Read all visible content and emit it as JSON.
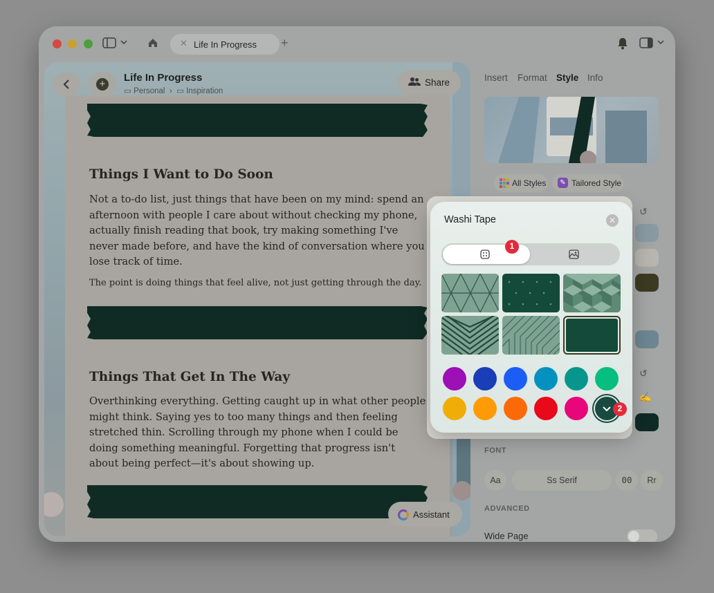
{
  "window": {
    "tab_title": "Life In Progress"
  },
  "header": {
    "title": "Life In Progress",
    "breadcrumb": [
      "Personal",
      "Inspiration"
    ],
    "share_label": "Share"
  },
  "document": {
    "section1_heading": "Things I Want to Do Soon",
    "section1_body": "Not a to-do list, just things that have been on my mind: spend an afternoon with people I care about without checking my phone, actually finish reading that book, try making something I've never made before, and have the kind of conversation where you lose track of time.",
    "section1_note": "The point is doing things that feel alive, not just getting through the day.",
    "section2_heading": "Things That Get In The Way",
    "section2_body": "Overthinking everything. Getting caught up in what other people might think. Saying yes to too many things and then feeling stretched thin. Scrolling through my phone when I could be doing something meaningful. Forgetting that progress isn't about being perfect—it's about showing up.",
    "assistant_label": "Assistant"
  },
  "sidebar": {
    "tabs": [
      "Insert",
      "Format",
      "Style",
      "Info"
    ],
    "active_tab": "Style",
    "all_styles_label": "All Styles",
    "tailored_style_label": "Tailored Style",
    "font_section_label": "FONT",
    "font_options": [
      "Aa",
      "Ss Serif",
      "00",
      "Rr"
    ],
    "advanced_label": "ADVANCED",
    "wide_page_label": "Wide Page",
    "swatch_color": "#0f2b24"
  },
  "popover": {
    "title": "Washi Tape",
    "badges": [
      "1",
      "2"
    ],
    "selected_segment": "pattern",
    "patterns": [
      "triangles",
      "dots",
      "cubes",
      "chevrons",
      "lines",
      "solid"
    ],
    "selected_pattern": "solid",
    "colors": [
      "#9c10b5",
      "#1a3db8",
      "#1c5ef5",
      "#0591c0",
      "#06968d",
      "#07bd80",
      "#f0ad07",
      "#ff9b06",
      "#fc6a08",
      "#e8091b",
      "#e8067a",
      "#194a40"
    ],
    "selected_color": "#194a40"
  }
}
